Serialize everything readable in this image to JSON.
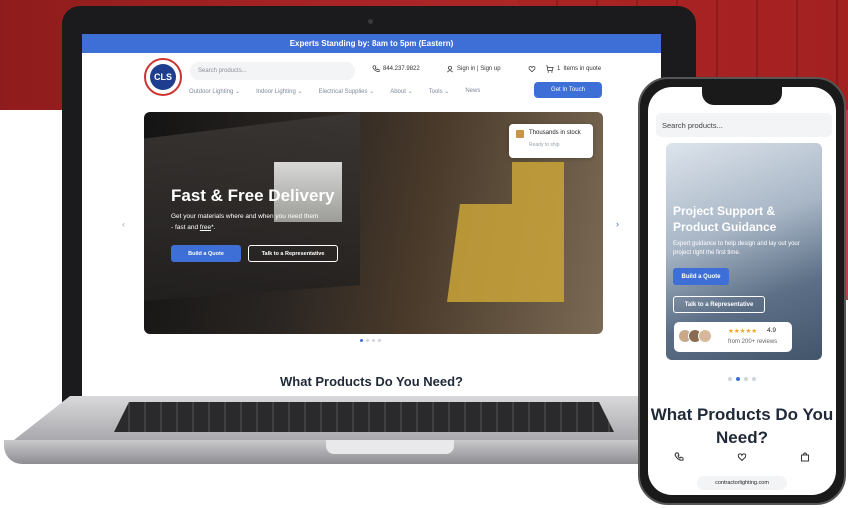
{
  "laptop_site": {
    "topbar_text": "Experts Standing by: 8am to 5pm (Eastern)",
    "logo_text": "CLS",
    "search_placeholder": "Search products...",
    "phone": "844.237.9822",
    "account": "Sign in | Sign up",
    "quote": "Items in quote",
    "quote_count": "1",
    "nav": [
      "Outdoor Lighting",
      "Indoor Lighting",
      "Electrical Supplies",
      "About",
      "Tools",
      "News"
    ],
    "cta": "Get In Touch",
    "hero": {
      "title": "Fast & Free Delivery",
      "subtitle_part1": "Get your materials where and when you need them - fast and ",
      "subtitle_free": "free",
      "subtitle_part2": "*.",
      "btn_primary": "Build a Quote",
      "btn_secondary": "Talk to a Representative"
    },
    "stock_badge": {
      "title": "Thousands in stock",
      "subtitle": "Ready to ship"
    },
    "section_title": "What Products Do You Need?"
  },
  "phone_site": {
    "search_placeholder": "Search products...",
    "hero": {
      "title": "Project Support & Product Guidance",
      "subtitle": "Expert guidance to help design and lay out your project right the first time.",
      "btn_primary": "Build a Quote",
      "btn_secondary": "Talk to a Representative"
    },
    "rating": {
      "stars": "★★★★★",
      "score": "4.9",
      "reviews": "from 200+ reviews"
    },
    "section_title": "What Products Do You Need?",
    "url": "contractorlighting.com"
  },
  "colors": {
    "brand_blue": "#3d6fd6",
    "brand_red": "#a82424"
  }
}
